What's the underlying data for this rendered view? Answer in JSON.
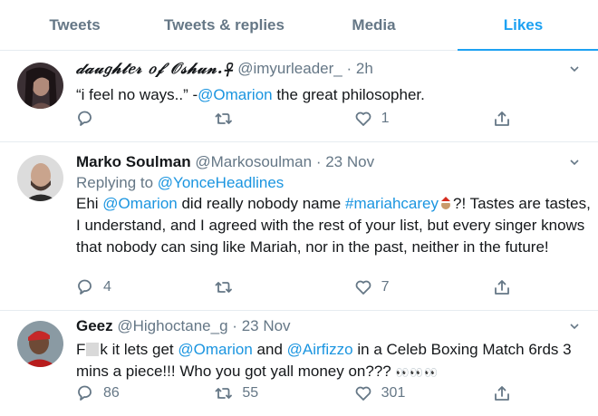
{
  "tabs": [
    "Tweets",
    "Tweets & replies",
    "Media",
    "Likes"
  ],
  "active_tab": 3,
  "tweets": [
    {
      "display_name": "𝒹𝒶𝓊𝑔𝒽𝓉𝑒𝓇 𝑜𝒻 𝒪𝓈𝒽𝓊𝓃.☥",
      "handle": "@imyurleader_",
      "time": "2h",
      "text_parts": [
        "“i feel no ways..” -",
        "@Omarion",
        " the great philosopher."
      ],
      "replies": "",
      "retweets": "",
      "likes": "1"
    },
    {
      "display_name": "Marko Soulman",
      "handle": "@Markosoulman",
      "time": "23 Nov",
      "reply_label": "Replying to ",
      "reply_handle": "@YonceHeadlines",
      "text_parts": [
        "Ehi ",
        "@Omarion",
        " did really nobody name ",
        "#mariahcarey",
        "?! Tastes are tastes, I understand, and I agreed with the rest of your list, but every singer knows that nobody can sing like Mariah, nor in the past, neither in the future!"
      ],
      "replies": "4",
      "retweets": "",
      "likes": "7"
    },
    {
      "display_name": "Geez",
      "handle": "@Highoctane_g",
      "time": "23 Nov",
      "text_parts": [
        "F",
        "k it lets get ",
        "@Omarion",
        " and ",
        "@Airfizzo",
        " in a Celeb Boxing Match 6rds 3 mins a piece!!! Who you got yall money on??? ",
        "👀👀👀"
      ],
      "replies": "86",
      "retweets": "55",
      "likes": "301"
    }
  ],
  "dot": "·",
  "icons": [
    "reply-icon",
    "retweet-icon",
    "like-icon",
    "share-icon",
    "caret-down-icon"
  ],
  "colors": {
    "accent": "#1da1f2",
    "link": "#1b95e0",
    "muted": "#657786"
  }
}
